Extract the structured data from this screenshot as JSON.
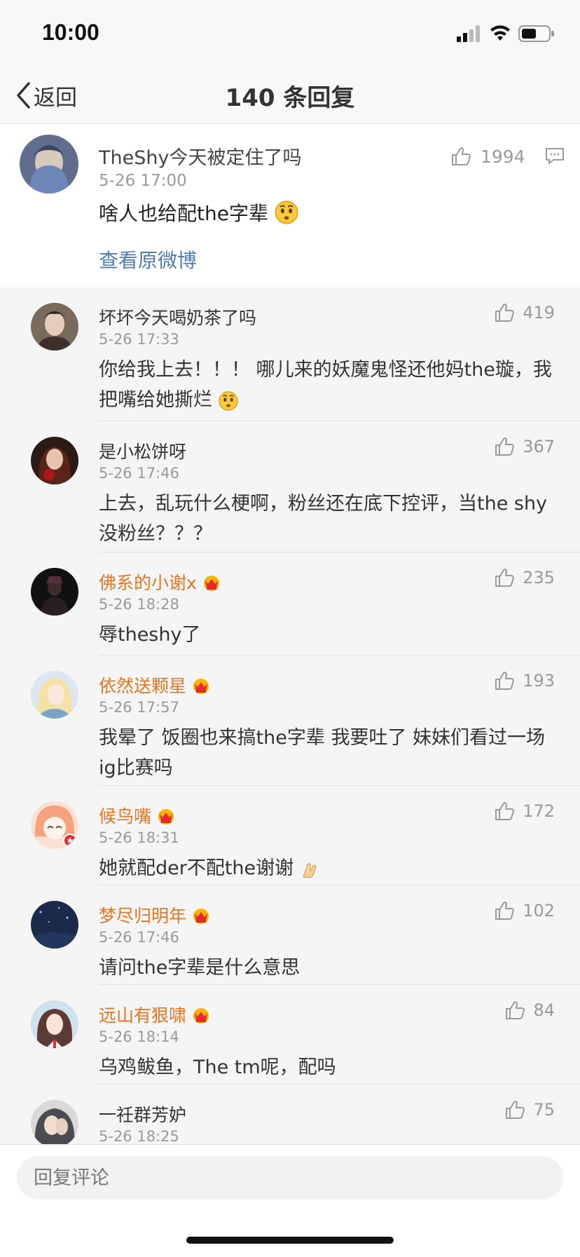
{
  "status_bar": {
    "time": "10:00"
  },
  "nav": {
    "back_label": "返回",
    "title": "140 条回复"
  },
  "main_comment": {
    "name": "TheShy今天被定住了吗",
    "time": "5-26 17:00",
    "text": "啥人也给配the字辈",
    "likes": "1994",
    "view_original": "查看原微博",
    "emoji": "confused-face-emoji"
  },
  "replies": [
    {
      "name": "坏坏今天喝奶茶了吗",
      "time": "5-26 17:33",
      "text": "你给我上去！！！ 哪儿来的妖魔鬼怪还他妈the璇，我把嘴给她撕烂",
      "likes": "419",
      "vip": false
    },
    {
      "name": "是小松饼呀",
      "time": "5-26 17:46",
      "text": "上去，乱玩什么梗啊，粉丝还在底下控评，当the shy没粉丝？？？",
      "likes": "367",
      "vip": false
    },
    {
      "name": "佛系的小谢x",
      "time": "5-26 18:28",
      "text": "辱theshy了",
      "likes": "235",
      "vip": true
    },
    {
      "name": "依然送颗星",
      "time": "5-26 17:57",
      "text": "我晕了 饭圈也来搞the字辈 我要吐了 妹妹们看过一场ig比赛吗",
      "likes": "193",
      "vip": true
    },
    {
      "name": "候鸟嘴",
      "time": "5-26 18:31",
      "text": "她就配der不配the谢谢",
      "likes": "172",
      "vip": true
    },
    {
      "name": "梦尽归明年",
      "time": "5-26 17:46",
      "text": "请问the字辈是什么意思",
      "likes": "102",
      "vip": true
    },
    {
      "name": "远山有狠啸",
      "time": "5-26 18:14",
      "text": "乌鸡鲅鱼，The tm呢，配吗",
      "likes": "84",
      "vip": true
    },
    {
      "name": "一祍群芳妒",
      "time": "5-26 18:25",
      "text": "",
      "likes": "75",
      "vip": false
    }
  ],
  "bottom_bar": {
    "reply_placeholder": "回复评论"
  },
  "colors": {
    "vip_name": "#e8741f",
    "link": "#507daf",
    "muted": "#999999"
  }
}
